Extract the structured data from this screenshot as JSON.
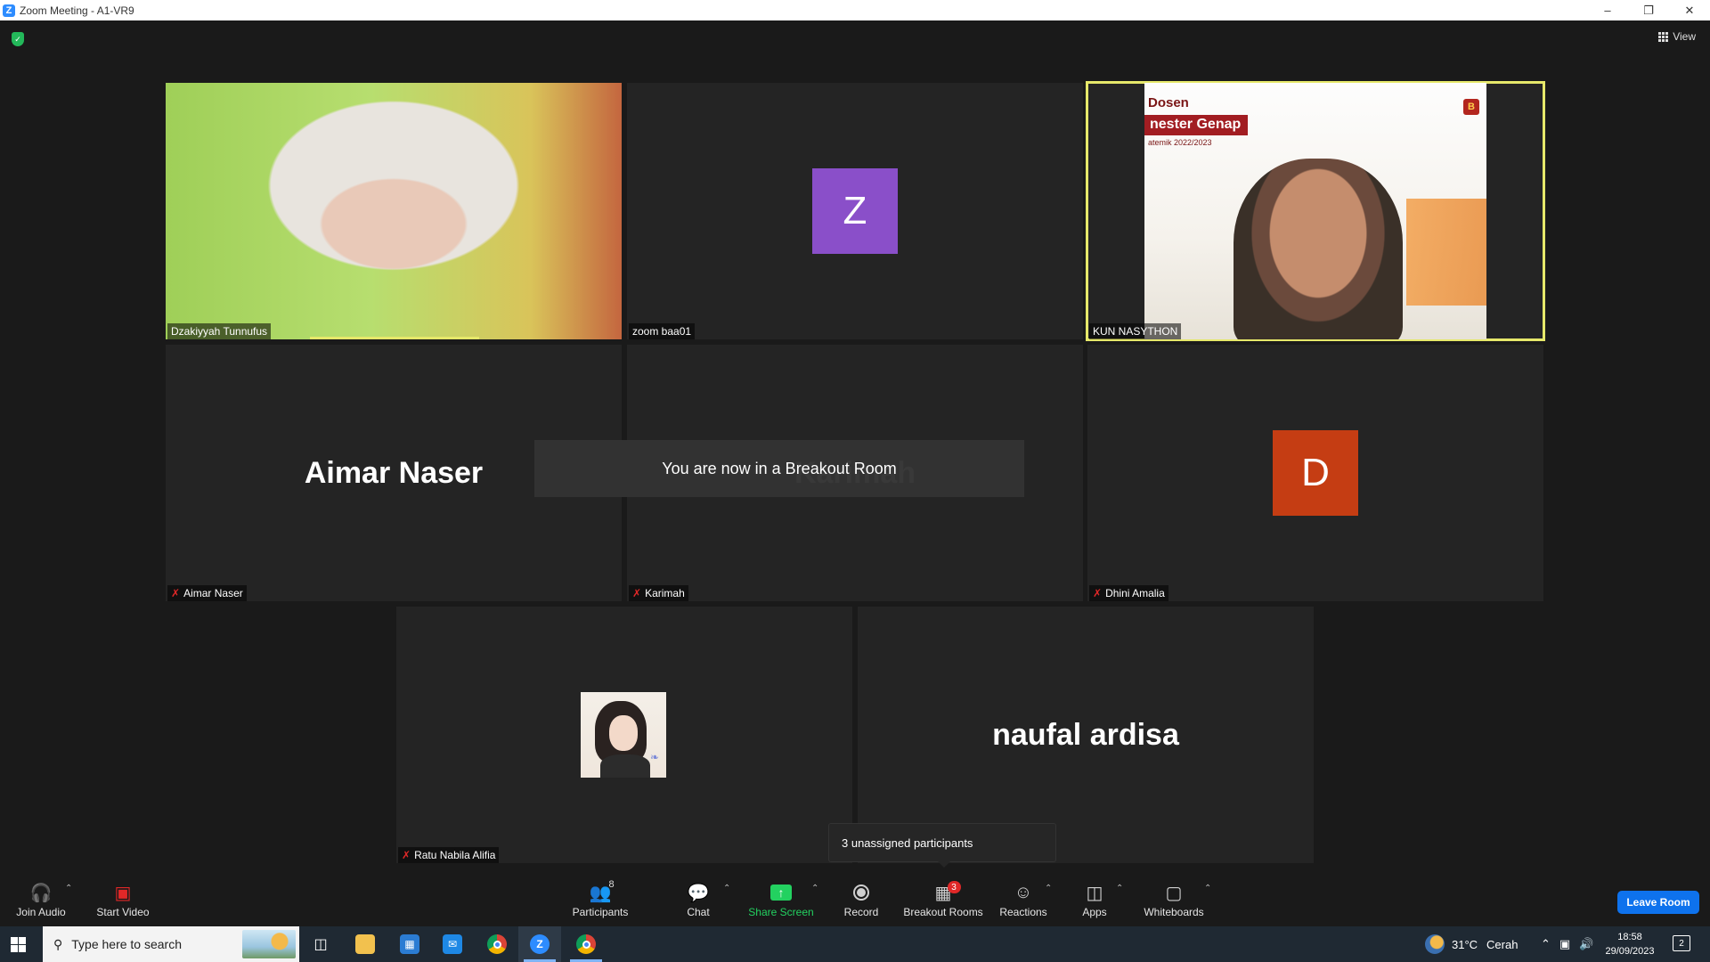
{
  "window": {
    "title": "Zoom Meeting - A1-VR9",
    "minimize_icon": "minimize-icon",
    "restore_icon": "restore-icon",
    "close_icon": "close-icon"
  },
  "meeting_bar": {
    "security_icon": "shield-check-icon",
    "view_label": "View"
  },
  "tiles": [
    {
      "name": "Dzakiyyah Tunnufus",
      "type": "video",
      "muted": false,
      "speaking": true
    },
    {
      "name": "zoom baa01",
      "type": "avatar-letter",
      "letter": "Z",
      "avatar_color": "#8a4fc9",
      "muted": false
    },
    {
      "name": "KUN NASYTHON",
      "type": "video",
      "muted": false,
      "active": true,
      "screen_text": {
        "line1": "Dosen",
        "banner": "nester Genap",
        "line3": "atemik 2022/2023",
        "logo": "B"
      }
    },
    {
      "name": "Aimar Naser",
      "type": "name-only",
      "display_name": "Aimar Naser",
      "muted": true
    },
    {
      "name": "Karimah",
      "type": "name-only",
      "display_name": "Karimah",
      "muted": true
    },
    {
      "name": "Dhini Amalia",
      "type": "avatar-letter",
      "letter": "D",
      "avatar_color": "#c53d13",
      "muted": true
    },
    {
      "name": "Ratu Nabila Alifia",
      "type": "profile-picture",
      "muted": true
    },
    {
      "name": "naufal ardisa",
      "type": "name-only",
      "display_name": "naufal ardisa",
      "muted": false
    }
  ],
  "toast": {
    "message": "You are now in a Breakout Room"
  },
  "tooltip": {
    "text": "3 unassigned participants"
  },
  "toolbar": {
    "join_audio": "Join Audio",
    "start_video": "Start Video",
    "participants": "Participants",
    "participants_count": "8",
    "chat": "Chat",
    "share_screen": "Share Screen",
    "record": "Record",
    "breakout_rooms": "Breakout Rooms",
    "breakout_badge": "3",
    "reactions": "Reactions",
    "apps": "Apps",
    "whiteboards": "Whiteboards",
    "leave_room": "Leave Room"
  },
  "taskbar": {
    "search_placeholder": "Type here to search",
    "weather_temp": "31°C",
    "weather_desc": "Cerah",
    "time": "18:58",
    "date": "29/09/2023",
    "notifications_count": "2"
  },
  "colors": {
    "active_speaker": "#e6e86a",
    "leave_button": "#0e72ed",
    "share_green": "#23d160",
    "muted_red": "#e02828"
  }
}
